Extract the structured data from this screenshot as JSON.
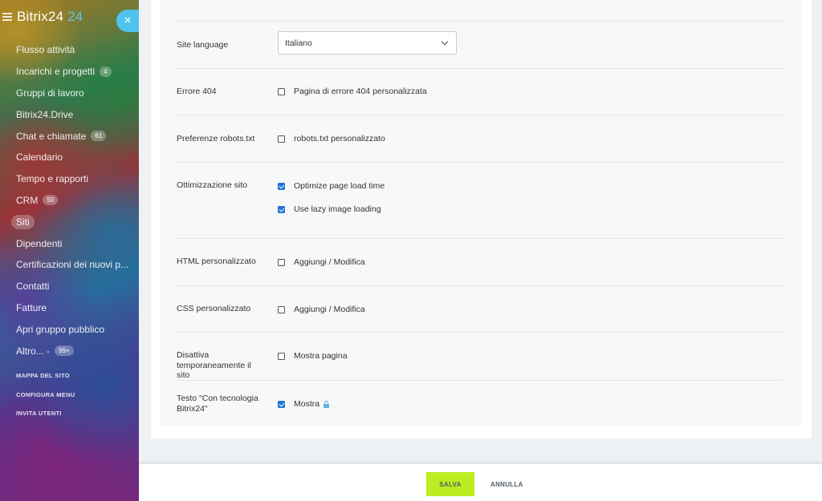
{
  "sidebar": {
    "logo": "Bitrix24",
    "logo_num": "24",
    "items": [
      {
        "label": "Flusso attività",
        "badge": ""
      },
      {
        "label": "Incarichi e progetti",
        "badge": "4"
      },
      {
        "label": "Gruppi di lavoro",
        "badge": ""
      },
      {
        "label": "Bitrix24.Drive",
        "badge": ""
      },
      {
        "label": "Chat e chiamate",
        "badge": "61"
      },
      {
        "label": "Calendario",
        "badge": ""
      },
      {
        "label": "Tempo e rapporti",
        "badge": ""
      },
      {
        "label": "CRM",
        "badge": "50"
      },
      {
        "label": "Siti",
        "badge": "",
        "active": true
      },
      {
        "label": "Dipendenti",
        "badge": ""
      },
      {
        "label": "Certificazioni dei nuovi p...",
        "badge": ""
      },
      {
        "label": "Contatti",
        "badge": ""
      },
      {
        "label": "Fatture",
        "badge": ""
      },
      {
        "label": "Apri gruppo pubblico",
        "badge": ""
      },
      {
        "label": "Altro... -",
        "badge": "99+"
      }
    ],
    "links": [
      "MAPPA DEL SITO",
      "CONFIGURA MENU",
      "INVITA UTENTI"
    ]
  },
  "close_label": "×",
  "settings": {
    "language": {
      "label": "Site language",
      "value": "Italiano"
    },
    "error404": {
      "label": "Errore 404",
      "option": "Pagina di errore 404 personalizzata",
      "checked": false
    },
    "robots": {
      "label": "Preferenze robots.txt",
      "option": "robots.txt personalizzato",
      "checked": false
    },
    "optimization": {
      "label": "Ottimizzazione sito",
      "options": [
        {
          "label": "Optimize page load time",
          "checked": true
        },
        {
          "label": "Use lazy image loading",
          "checked": true
        }
      ]
    },
    "html": {
      "label": "HTML personalizzato",
      "option": "Aggiungi / Modifica",
      "checked": false
    },
    "css": {
      "label": "CSS personalizzato",
      "option": "Aggiungi / Modifica",
      "checked": false
    },
    "disable": {
      "label_lines": [
        "Disattiva",
        "temporaneamente il",
        "sito"
      ],
      "option": "Mostra pagina",
      "checked": false
    },
    "powered": {
      "label_lines": [
        "Testo \"Con tecnologia",
        "Bitrix24\""
      ],
      "option": "Mostra",
      "checked": true
    }
  },
  "footer": {
    "save": "SALVA",
    "cancel": "ANNULLA"
  },
  "colors": {
    "accent": "#4fc3f0",
    "save": "#bbed21",
    "checkbox": "#2176d2"
  }
}
